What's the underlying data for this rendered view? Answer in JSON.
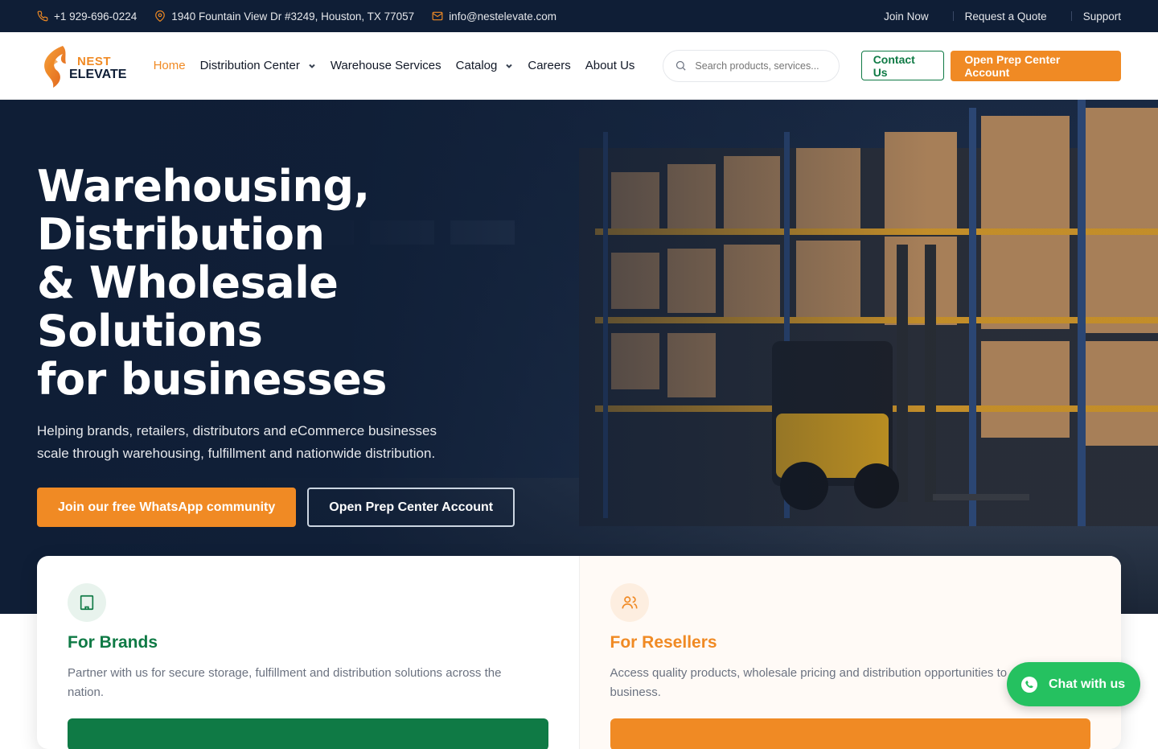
{
  "topbar": {
    "phone": "+1 929-696-0224",
    "address": "1940 Fountain View Dr #3249, Houston, TX 77057",
    "email": "info@nestelevate.com",
    "links": [
      "Join Now",
      "Request a Quote",
      "Support"
    ]
  },
  "logo": {
    "line1": "NEST",
    "line2": "ELEVATE"
  },
  "nav": {
    "items": [
      {
        "label": "Home",
        "active": true
      },
      {
        "label": "Distribution Center"
      },
      {
        "label": "Warehouse Services"
      },
      {
        "label": "Catalog"
      },
      {
        "label": "Careers"
      },
      {
        "label": "About Us"
      }
    ],
    "search_placeholder": "Search products, services...",
    "contact_label": "Contact Us",
    "prep_label": "Open Prep Center Account"
  },
  "hero": {
    "title_lines": [
      "Warehousing,",
      "Distribution",
      "& Wholesale Solutions",
      "for businesses"
    ],
    "subtitle": "Helping brands, retailers, distributors and eCommerce businesses scale through warehousing, fulfillment and nationwide distribution.",
    "btn_primary": "Join our free WhatsApp community",
    "btn_secondary": "Open Prep Center Account"
  },
  "cards": [
    {
      "title": "For Brands",
      "desc": "Partner with us for secure storage, fulfillment and distribution solutions across the nation.",
      "icon": "building-icon",
      "color": "#0f7a45"
    },
    {
      "title": "For Resellers",
      "desc": "Access quality products, wholesale pricing and distribution opportunities to grow your business.",
      "icon": "users-icon",
      "color": "#f08a24"
    }
  ],
  "chat": {
    "label": "Chat with us"
  },
  "colors": {
    "accent": "#f08a24",
    "navy": "#0f1e36",
    "green": "#0f7a45",
    "whatsapp": "#25c160"
  }
}
